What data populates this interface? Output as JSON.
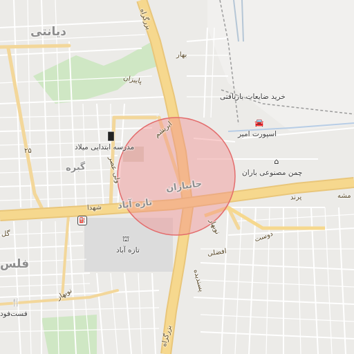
{
  "map": {
    "labels": {
      "deyanati": "دیانتی",
      "bahar": "بهار",
      "paeizan": "پاییزان",
      "kharid": "خرید ضایعات بازیافتی",
      "esport": "اسپورت امیر",
      "madrese": "مدرسه ابتدایی میلاد",
      "chaman": "چمن مصنوعی باران",
      "ghebre": "گبره",
      "janbazan": "جانبازان",
      "tazeabad_big": "تازه آباد",
      "shohada": "شهدا",
      "parand": "پرند",
      "moshe": "مشه",
      "gol": "گل",
      "felestin": "فلس",
      "tazeabad_poi": "تازه آباد",
      "nobahar": "نوبهار",
      "fastfood": "فست‌فود",
      "afzali": "افضلی",
      "nobahar2": "نوبهار",
      "valiasr": "ولی عصر",
      "arghavan": "ارغوان",
      "mosaddegh": "پسندیده",
      "bozorgrah_top": "بزرگراه",
      "bozorgrah_bottom": "بزرگراه",
      "dost": "دوست",
      "ibrisham": "ابریشم",
      "num25": "۲۵"
    },
    "icons": {
      "school": "school-icon",
      "car": "car-icon",
      "sports": "sports-icon",
      "landmark": "landmark-icon",
      "fuel": "fuel-icon",
      "restaurant": "restaurant-icon"
    },
    "highlight_color": "#f4a2a2"
  }
}
